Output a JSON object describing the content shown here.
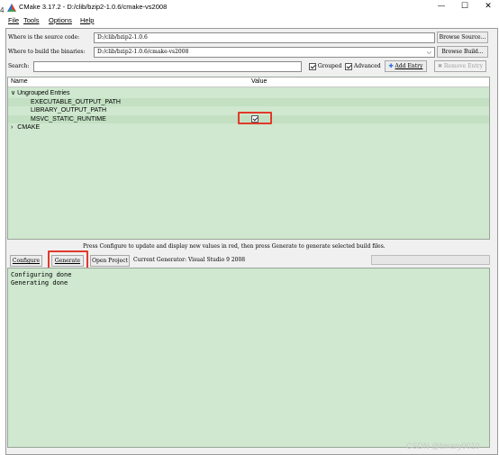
{
  "window": {
    "title": "CMake 3.17.2 - D:/clib/bzip2-1.0.6/cmake-vs2008",
    "edge_char": "4",
    "min_label": "—",
    "max_label": "☐",
    "close_label": "✕"
  },
  "menu": [
    "File",
    "Tools",
    "Options",
    "Help"
  ],
  "source": {
    "label": "Where is the source code:",
    "value": "D:/clib/bzip2-1.0.6",
    "button": "Browse Source..."
  },
  "binaries": {
    "label": "Where to build the binaries:",
    "value": "D:/clib/bzip2-1.0.6/cmake-vs2008",
    "button": "Browse Build..."
  },
  "search": {
    "label": "Search:",
    "value": "",
    "grouped_label": "Grouped",
    "grouped_checked": true,
    "advanced_label": "Advanced",
    "advanced_checked": true,
    "add_entry": "Add Entry",
    "remove_entry": "Remove Entry"
  },
  "table": {
    "headers": [
      "Name",
      "Value"
    ],
    "group1": {
      "label": "Ungrouped Entries",
      "expanded": true
    },
    "entries": [
      {
        "name": "EXECUTABLE_OUTPUT_PATH",
        "value": ""
      },
      {
        "name": "LIBRARY_OUTPUT_PATH",
        "value": ""
      },
      {
        "name": "MSVC_STATIC_RUNTIME",
        "value": "checkbox",
        "checked": true
      }
    ],
    "group2": {
      "label": "CMAKE",
      "expanded": false
    }
  },
  "status_message": "Press Configure to update and display new values in red, then press Generate to generate selected build files.",
  "actions": {
    "configure": "Configure",
    "generate": "Generate",
    "open_project": "Open Project",
    "generator": "Current Generator: Visual Studio 9 2008"
  },
  "output": [
    "Configuring done",
    "Generating done"
  ],
  "watermark": "CSDN @binary0010",
  "colors": {
    "panel_green": "#cfe8cf",
    "highlight_red": "#e03a2a",
    "accent_blue": "#2a6fdb"
  }
}
